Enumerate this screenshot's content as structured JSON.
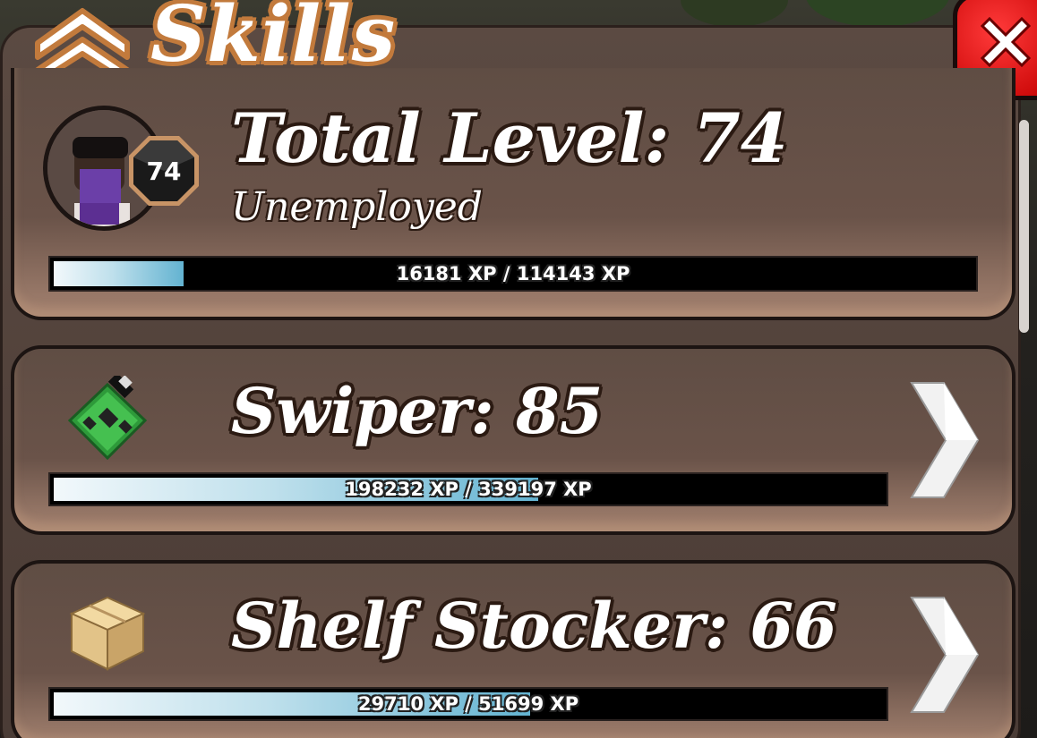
{
  "header": {
    "title": "Skills",
    "collapse_icon": "double-chevron-up-icon",
    "close_icon": "close-x-icon"
  },
  "total": {
    "title": "Total Level: 74",
    "level_badge": "74",
    "job": "Unemployed",
    "xp_text": "16181 XP / 114143 XP",
    "xp_fraction": 0.1418
  },
  "skills": [
    {
      "title": "Swiper: 85",
      "icon": "circuit-board-icon",
      "xp_text": "198232 XP / 339197 XP",
      "xp_fraction": 0.5844,
      "arrow_icon": "chevron-right-icon"
    },
    {
      "title": "Shelf Stocker: 66",
      "icon": "cardboard-box-icon",
      "xp_text": "29710 XP / 51699 XP",
      "xp_fraction": 0.5747,
      "arrow_icon": "chevron-right-icon"
    }
  ],
  "colors": {
    "panel": "#5b4a42",
    "title_outline": "#c27a3c",
    "close_red": "#e00000",
    "xp_fill": "#63b3d1"
  }
}
